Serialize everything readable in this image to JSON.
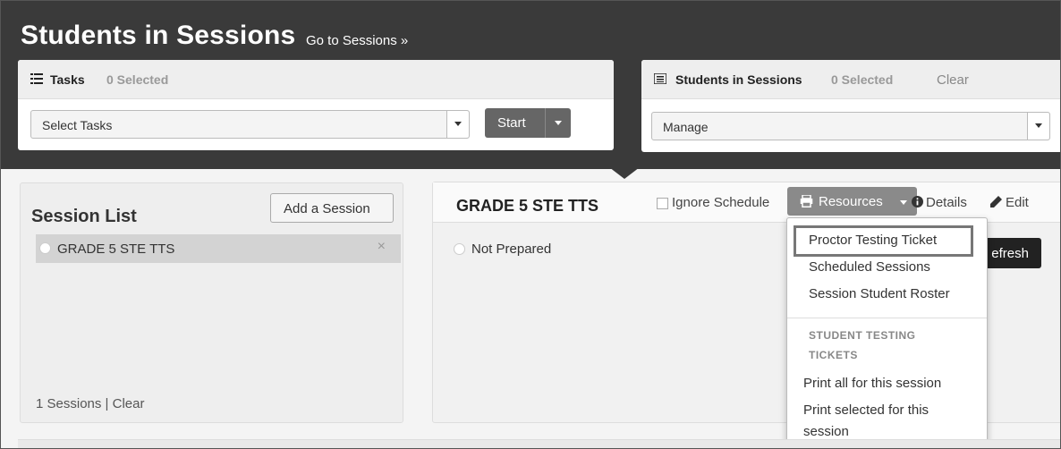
{
  "header": {
    "title": "Students in Sessions",
    "goto_link": "Go to Sessions »"
  },
  "tasks_panel": {
    "title": "Tasks",
    "selected_count": "0 Selected",
    "select_value": "Select Tasks",
    "start_label": "Start"
  },
  "students_panel": {
    "title": "Students in Sessions",
    "selected_count": "0 Selected",
    "clear_label": "Clear",
    "select_value": "Manage"
  },
  "session_list": {
    "title": "Session List",
    "add_button": "Add a Session",
    "items": [
      {
        "name": "GRADE 5 STE TTS",
        "remove_icon": "×"
      }
    ],
    "footer_count": "1 Sessions",
    "footer_sep": " | ",
    "footer_clear": "Clear"
  },
  "session_detail": {
    "title": "GRADE 5 STE TTS",
    "ignore_schedule_label": "Ignore Schedule",
    "resources_label": "Resources",
    "details_label": "Details",
    "edit_label": "Edit",
    "status": "Not Prepared",
    "refresh_label": "efresh"
  },
  "resources_menu": {
    "items": [
      "Proctor Testing Ticket",
      "Scheduled Sessions",
      "Session Student Roster"
    ],
    "section_header_line1": "STUDENT TESTING",
    "section_header_line2": "TICKETS",
    "sub_items": [
      "Print all for this session",
      "Print selected for this",
      "session"
    ]
  },
  "icons": {
    "list": "list-icon",
    "printer": "printer-icon",
    "info": "info-icon",
    "pencil": "pencil-icon"
  },
  "colors": {
    "header_bg": "#3a3a3a",
    "resources_bg": "#8a8a8a",
    "highlight_border": "#777777"
  }
}
